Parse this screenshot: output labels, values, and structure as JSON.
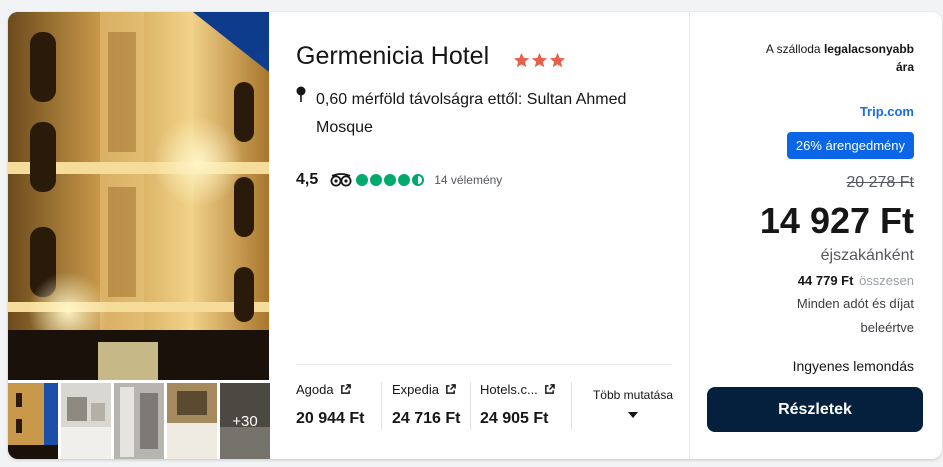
{
  "hotel": {
    "name": "Germenicia Hotel",
    "star_rating": 3,
    "distance_text": "0,60 mérföld távolságra ettől: Sultan Ahmed Mosque",
    "rating": "4,5",
    "review_bubbles": 4.5,
    "review_count": "14 vélemény",
    "more_photos": "+30"
  },
  "providers": [
    {
      "name": "Agoda",
      "price": "20 944 Ft"
    },
    {
      "name": "Expedia",
      "price": "24 716 Ft"
    },
    {
      "name": "Hotels.c...",
      "price": "24 905 Ft"
    }
  ],
  "show_more_label": "Több mutatása",
  "offer": {
    "lowest_prefix": "A szálloda",
    "lowest_bold": "legalacsonyabb",
    "lowest_suffix": "ára",
    "partner": "Trip.com",
    "discount": "26% árengedmény",
    "old_price": "20 278 Ft",
    "price": "14 927 Ft",
    "per_night": "éjszakánként",
    "total_value": "44 779 Ft",
    "total_label": "összesen",
    "taxes": "Minden adót és díjat beleértve",
    "free_cancellation": "Ingyenes lemondás",
    "button_label": "Részletek"
  },
  "colors": {
    "star": "#e8604c",
    "bubble": "#00aa6c",
    "partner": "#1a6ce6",
    "badge": "#0a66e6",
    "button": "#05203c"
  },
  "icons": {
    "location": "map-pin-icon",
    "tripadvisor": "tripadvisor-owl-icon",
    "external": "external-link-icon",
    "dropdown": "caret-down-icon"
  }
}
